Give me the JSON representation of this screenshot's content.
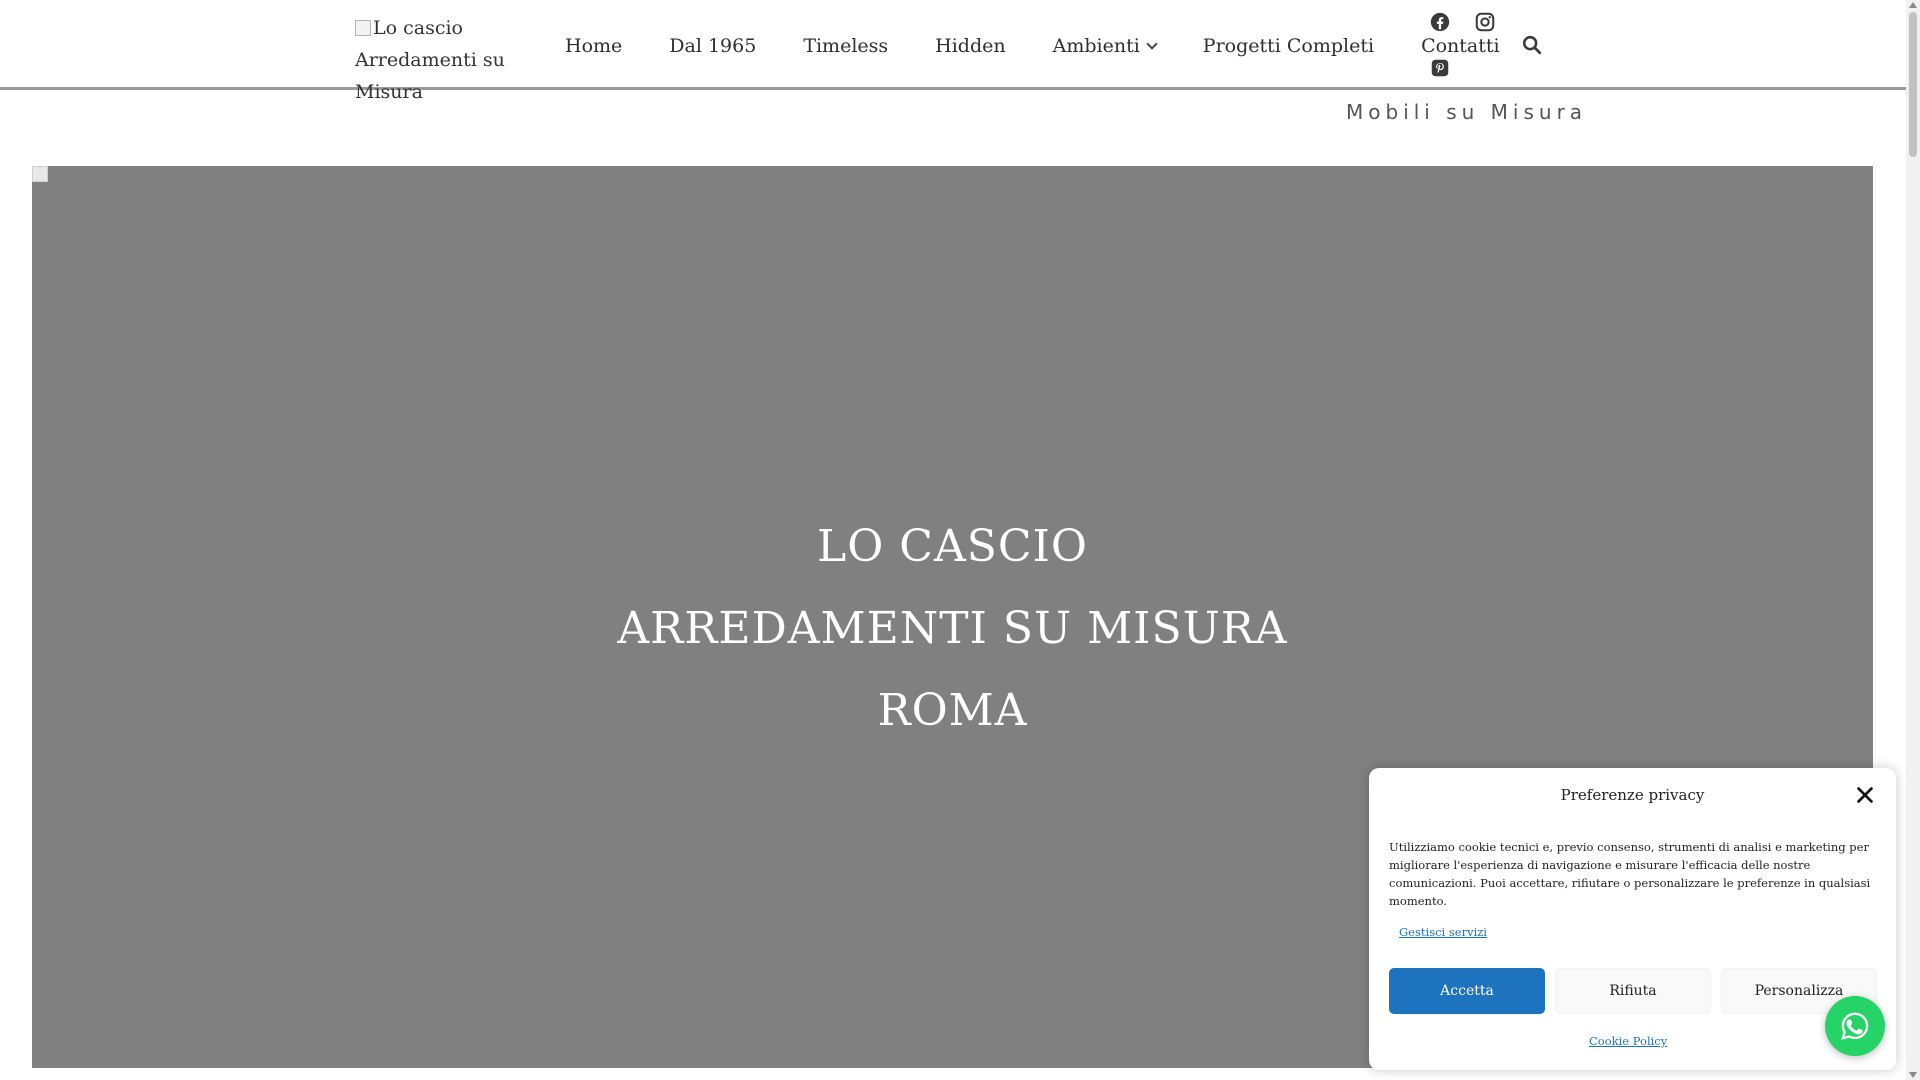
{
  "header": {
    "logo_alt": "Lo cascio Arredamenti su Misura",
    "nav": [
      {
        "label": "Home"
      },
      {
        "label": "Dal 1965"
      },
      {
        "label": "Timeless"
      },
      {
        "label": "Hidden"
      },
      {
        "label": "Ambienti"
      },
      {
        "label": "Progetti Completi"
      },
      {
        "label": "Contatti"
      }
    ],
    "social_icons": [
      "facebook-icon",
      "instagram-icon",
      "pinterest-icon"
    ],
    "search_icon": "search-icon"
  },
  "tagline": "Mobili su Misura",
  "hero": {
    "line1": "LO CASCIO",
    "line2": "ARREDAMENTI SU MISURA",
    "line3": "ROMA"
  },
  "cookie_banner": {
    "title": "Preferenze privacy",
    "text": "Utilizziamo cookie tecnici e, previo consenso, strumenti di analisi e marketing per migliorare l'esperienza di navigazione e misurare l'efficacia delle nostre comunicazioni. Puoi accettare, rifiutare o personalizzare le preferenze in qualsiasi momento.",
    "manage_label": "Gestisci servizi",
    "accept_label": "Accetta",
    "deny_label": "Rifiuta",
    "customize_label": "Personalizza",
    "policy_label": "Cookie Policy"
  },
  "colors": {
    "accent": "#1e73be",
    "hero_bg": "#808080",
    "whatsapp": "#25d366",
    "header_border": "#9b9b9b"
  }
}
